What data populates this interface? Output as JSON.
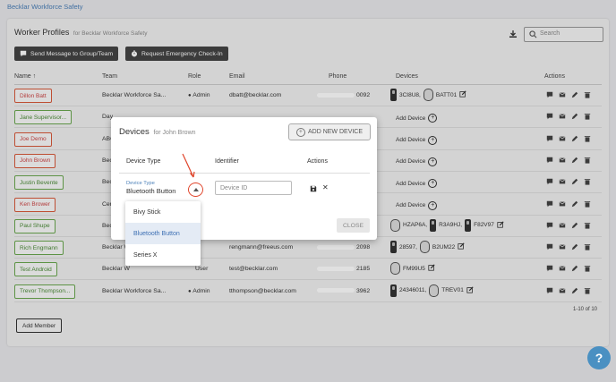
{
  "breadcrumb": "Becklar Workforce Safety",
  "page": {
    "title": "Worker Profiles",
    "subtitle": "for Becklar Workforce Safety",
    "search_placeholder": "Search",
    "send_message_label": "Send Message to Group/Team",
    "emergency_label": "Request Emergency Check-In",
    "add_member_label": "Add Member",
    "pagination": "1-10 of 10"
  },
  "table": {
    "headers": {
      "name": "Name",
      "team": "Team",
      "role": "Role",
      "email": "Email",
      "phone": "Phone",
      "devices": "Devices",
      "actions": "Actions"
    },
    "rows": [
      {
        "name": "Dillon Batt",
        "status": "red",
        "team": "Becklar Workforce Sa...",
        "role": "Admin",
        "role_icon": true,
        "email": "dbatt@becklar.com",
        "phone_suffix": "0092",
        "devices": [
          {
            "kind": "tall",
            "label": "3CI8U8,"
          },
          {
            "kind": "round",
            "label": "BATT01"
          }
        ],
        "edit": true
      },
      {
        "name": "Jane Supervisor...",
        "status": "green",
        "team": "Day",
        "role": "",
        "role_icon": false,
        "email": "",
        "phone_suffix": "",
        "add_device": "Add Device"
      },
      {
        "name": "Joe Demo",
        "status": "red",
        "team": "ABC",
        "role": "",
        "role_icon": false,
        "email": "",
        "phone_suffix": "",
        "add_device": "Add Device"
      },
      {
        "name": "John Brown",
        "status": "red",
        "team": "Bec",
        "role": "",
        "role_icon": false,
        "email": "",
        "phone_suffix": "",
        "add_device": "Add Device"
      },
      {
        "name": "Justin Bevente",
        "status": "green",
        "team": "Bec",
        "role": "",
        "role_icon": false,
        "email": "",
        "phone_suffix": "",
        "add_device": "Add Device"
      },
      {
        "name": "Ken Brower",
        "status": "red",
        "team": "Cen",
        "role": "",
        "role_icon": false,
        "email": "",
        "phone_suffix": "",
        "add_device": "Add Device"
      },
      {
        "name": "Paul Shupe",
        "status": "green",
        "team": "Bec",
        "role": "",
        "role_icon": false,
        "email": "",
        "phone_suffix": "",
        "devices": [
          {
            "kind": "round",
            "label": "HZAP6A,"
          },
          {
            "kind": "tall",
            "label": "R3A9HJ,"
          },
          {
            "kind": "tall",
            "label": "F82V97"
          }
        ],
        "edit": true
      },
      {
        "name": "Rich Engmann",
        "status": "green",
        "team": "Becklar W",
        "role": "",
        "role_icon": false,
        "email": "rengmann@freeus.com",
        "phone_suffix": "2098",
        "devices": [
          {
            "kind": "tall",
            "label": "28597,"
          },
          {
            "kind": "round",
            "label": "B2UM22"
          }
        ],
        "edit": true
      },
      {
        "name": "Test Android",
        "status": "green",
        "team": "Becklar W",
        "role": "User",
        "role_icon": false,
        "email": "test@becklar.com",
        "phone_suffix": "2185",
        "devices": [
          {
            "kind": "round",
            "label": "FM99U5"
          }
        ],
        "edit": true
      },
      {
        "name": "Trevor Thompson...",
        "status": "green",
        "team": "Becklar Workforce Sa...",
        "role": "Admin",
        "role_icon": true,
        "email": "tthompson@becklar.com",
        "phone_suffix": "3962",
        "devices": [
          {
            "kind": "tall",
            "label": "24346011,"
          },
          {
            "kind": "round",
            "label": "TREV01"
          }
        ],
        "edit": true
      }
    ]
  },
  "modal": {
    "title": "Devices",
    "subtitle": "for John Brown",
    "add_new_device_label": "ADD NEW DEVICE",
    "col_device_type": "Device Type",
    "col_identifier": "Identifier",
    "col_actions": "Actions",
    "device_type_field_label": "Device Type",
    "device_type_value": "Bluetooth Button",
    "identifier_placeholder": "Device ID",
    "close_label": "CLOSE"
  },
  "dropdown": {
    "options": [
      "Bivy Stick",
      "Bluetooth Button",
      "Series X"
    ],
    "selected": "Bluetooth Button"
  },
  "help_label": "?",
  "colors": {
    "accent": "#4a7fb8",
    "red_status": "#d9593b",
    "green_status": "#6aa84f",
    "annotation": "#e0442a"
  }
}
